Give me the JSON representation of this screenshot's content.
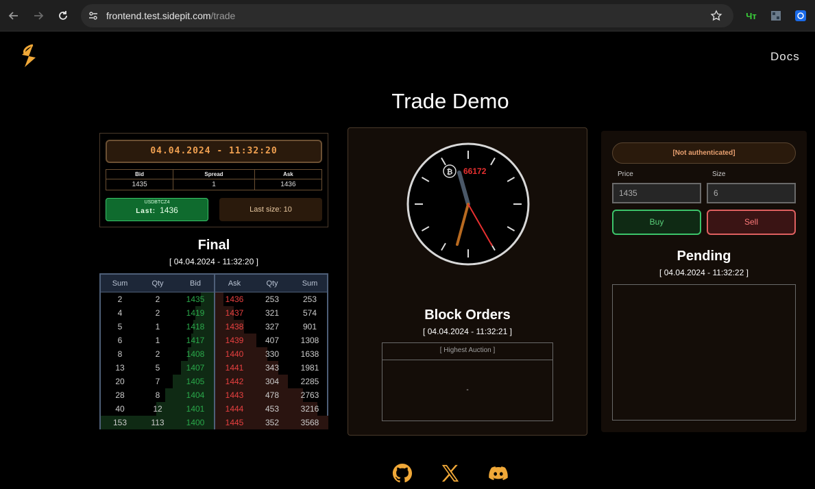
{
  "browser": {
    "url_host": "frontend.test.sidepit.com",
    "url_path": "/trade",
    "ext_label": "Чт"
  },
  "header": {
    "docs_label": "Docs",
    "title": "Trade Demo"
  },
  "ticker": {
    "datetime": "04.04.2024 - 11:32:20",
    "bid_label": "Bid",
    "spread_label": "Spread",
    "ask_label": "Ask",
    "bid": "1435",
    "spread": "1",
    "ask": "1436",
    "symbol": "USDBTCZ4",
    "last_label": "Last:",
    "last_value": "1436",
    "last_size": "Last size: 10"
  },
  "final": {
    "title": "Final",
    "time": "[ 04.04.2024 - 11:32:20 ]"
  },
  "book": {
    "headers": [
      "Sum",
      "Qty",
      "Bid",
      "Ask",
      "Qty",
      "Sum"
    ],
    "rows": [
      {
        "bsum": "2",
        "bqty": "2",
        "bid": "1435",
        "ask": "1436",
        "aqty": "253",
        "asum": "253"
      },
      {
        "bsum": "4",
        "bqty": "2",
        "bid": "1419",
        "ask": "1437",
        "aqty": "321",
        "asum": "574"
      },
      {
        "bsum": "5",
        "bqty": "1",
        "bid": "1418",
        "ask": "1438",
        "aqty": "327",
        "asum": "901"
      },
      {
        "bsum": "6",
        "bqty": "1",
        "bid": "1417",
        "ask": "1439",
        "aqty": "407",
        "asum": "1308"
      },
      {
        "bsum": "8",
        "bqty": "2",
        "bid": "1408",
        "ask": "1440",
        "aqty": "330",
        "asum": "1638"
      },
      {
        "bsum": "13",
        "bqty": "5",
        "bid": "1407",
        "ask": "1441",
        "aqty": "343",
        "asum": "1981"
      },
      {
        "bsum": "20",
        "bqty": "7",
        "bid": "1405",
        "ask": "1442",
        "aqty": "304",
        "asum": "2285"
      },
      {
        "bsum": "28",
        "bqty": "8",
        "bid": "1404",
        "ask": "1443",
        "aqty": "478",
        "asum": "2763"
      },
      {
        "bsum": "40",
        "bqty": "12",
        "bid": "1401",
        "ask": "1444",
        "aqty": "453",
        "asum": "3216"
      },
      {
        "bsum": "153",
        "bqty": "113",
        "bid": "1400",
        "ask": "1445",
        "aqty": "352",
        "asum": "3568"
      }
    ]
  },
  "block": {
    "clock_value": "66172",
    "title": "Block Orders",
    "time": "[ 04.04.2024 - 11:32:21 ]",
    "auction_header": "[ Highest Auction ]",
    "auction_value": "-"
  },
  "order_entry": {
    "auth_status": "[Not authenticated]",
    "price_label": "Price",
    "size_label": "Size",
    "price_value": "1435",
    "size_value": "6",
    "buy_label": "Buy",
    "sell_label": "Sell"
  },
  "pending": {
    "title": "Pending",
    "time": "[ 04.04.2024 - 11:32:22 ]"
  },
  "colors": {
    "bid_green": "#2aa84a",
    "ask_red": "#e84040",
    "accent_orange": "#f0a050"
  }
}
